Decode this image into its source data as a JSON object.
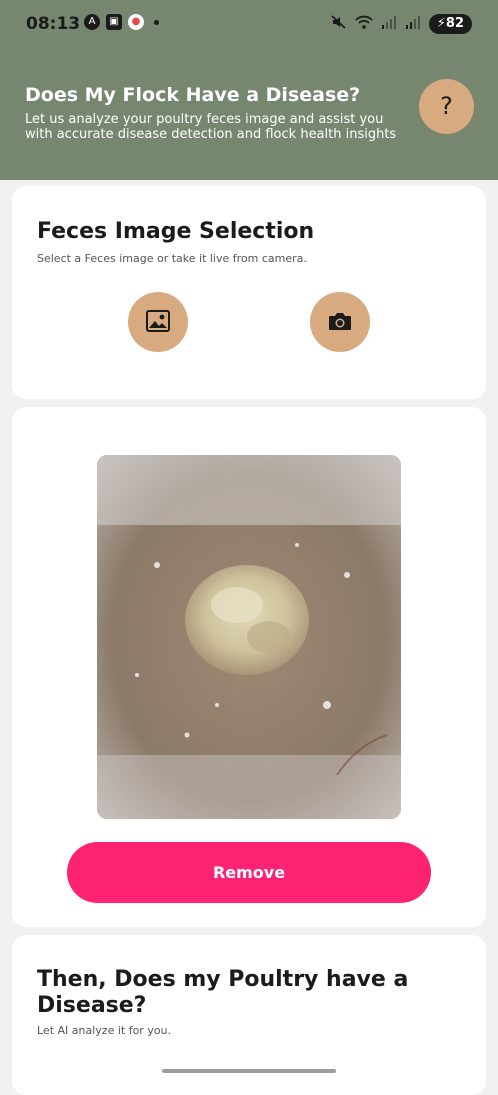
{
  "status_bar": {
    "time": "08:13",
    "battery": "82",
    "left_icons": [
      "a-icon",
      "screenshot-icon",
      "notification-icon"
    ],
    "right_icons": [
      "mute-icon",
      "wifi-icon",
      "signal-icon",
      "signal-icon-2"
    ]
  },
  "header": {
    "title": "Does My Flock Have a Disease?",
    "subtitle": "Let us analyze your poultry feces image and assist you with accurate disease detection and flock health insights",
    "help_label": "?",
    "background_color": "#77876f",
    "accent_color": "#d8aa80"
  },
  "selection_card": {
    "title": "Feces Image Selection",
    "subtitle": "Select a Feces image or take it live from camera.",
    "gallery_icon": "gallery-icon",
    "camera_icon": "camera-icon"
  },
  "preview_card": {
    "remove_label": "Remove",
    "remove_color": "#fd2372"
  },
  "analyze_card": {
    "title": "Then, Does my Poultry have a Disease?",
    "subtitle": "Let AI analyze it for you."
  }
}
